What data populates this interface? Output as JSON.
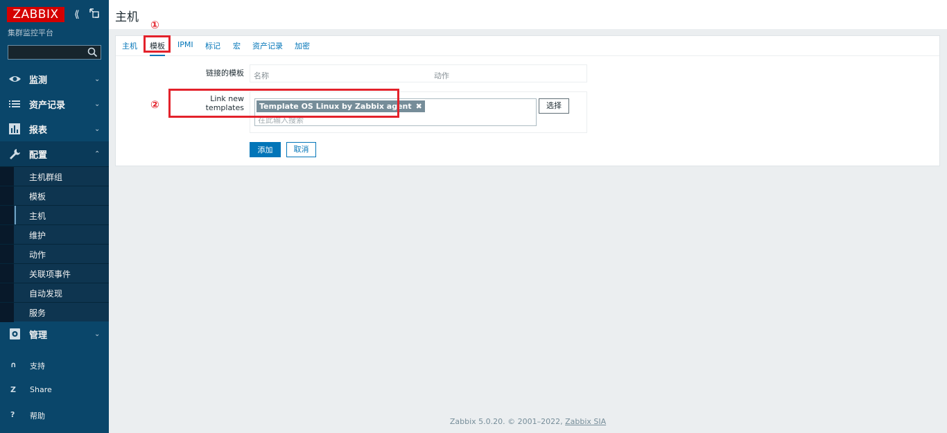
{
  "app": {
    "logo_text": "ZABBIX",
    "subtitle": "集群监控平台",
    "search_placeholder": ""
  },
  "sidebar": {
    "menu": [
      {
        "label": "监测",
        "icon": "eye-icon",
        "arrow": "⌄"
      },
      {
        "label": "资产记录",
        "icon": "list-icon",
        "arrow": "⌄"
      },
      {
        "label": "报表",
        "icon": "bar-chart-icon",
        "arrow": "⌄"
      },
      {
        "label": "配置",
        "icon": "wrench-icon",
        "arrow": "⌃"
      }
    ],
    "config_submenu": [
      {
        "label": "主机群组"
      },
      {
        "label": "模板"
      },
      {
        "label": "主机"
      },
      {
        "label": "维护"
      },
      {
        "label": "动作"
      },
      {
        "label": "关联项事件"
      },
      {
        "label": "自动发现"
      },
      {
        "label": "服务"
      }
    ],
    "admin": {
      "label": "管理",
      "icon": "gear-icon",
      "arrow": "⌄"
    },
    "bottom": [
      {
        "label": "支持",
        "icon": "headset-icon",
        "glyph": "∩"
      },
      {
        "label": "Share",
        "icon": "share-icon",
        "glyph": "Z"
      },
      {
        "label": "帮助",
        "icon": "help-icon",
        "glyph": "?"
      }
    ]
  },
  "page": {
    "title": "主机"
  },
  "tabs": [
    {
      "label": "主机"
    },
    {
      "label": "模板"
    },
    {
      "label": "IPMI"
    },
    {
      "label": "标记"
    },
    {
      "label": "宏"
    },
    {
      "label": "资产记录"
    },
    {
      "label": "加密"
    }
  ],
  "form": {
    "linked_label": "链接的模板",
    "linked_col_name": "名称",
    "linked_col_action": "动作",
    "link_new_label": "Link new templates",
    "selected_template": "Template OS Linux by Zabbix agent",
    "input_placeholder": "在此输入搜索",
    "select_button": "选择",
    "add_button": "添加",
    "cancel_button": "取消"
  },
  "annotations": {
    "step1": "①",
    "step2": "②",
    "color": "#e3222b"
  },
  "footer": {
    "text": "Zabbix 5.0.20. © 2001–2022, ",
    "link": "Zabbix SIA"
  }
}
